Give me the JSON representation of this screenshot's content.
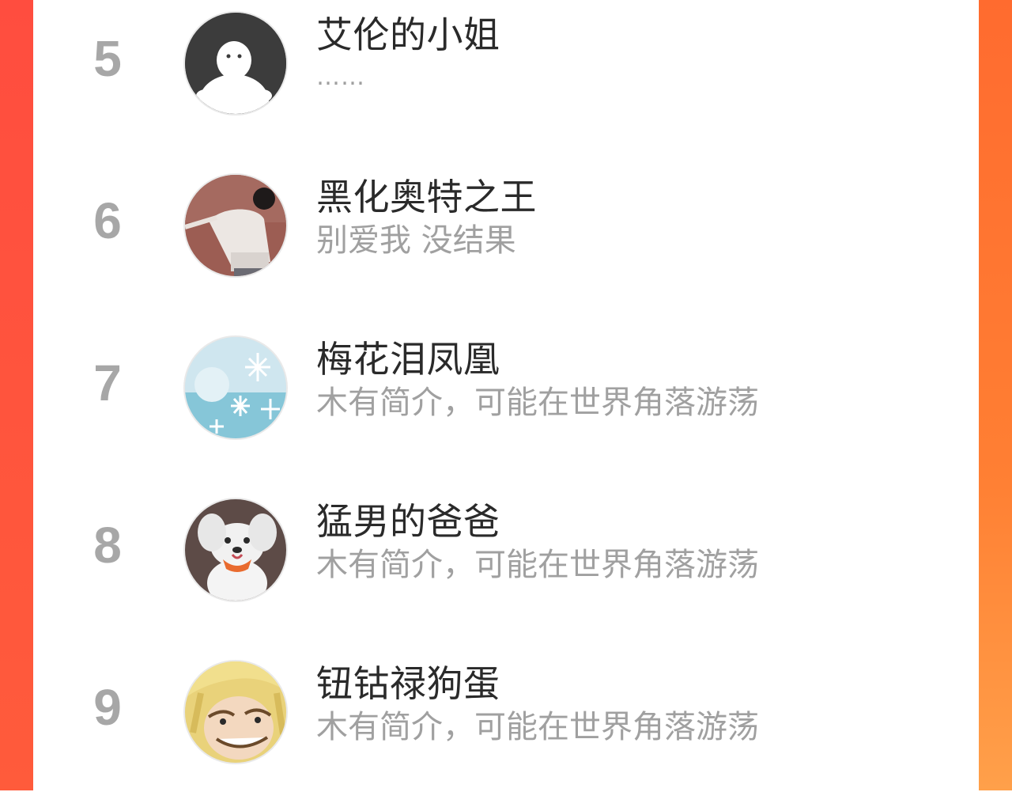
{
  "ranking_list": {
    "items": [
      {
        "rank": "5",
        "name": "艾伦的小姐",
        "intro": "……",
        "avatar": "default-user-avatar"
      },
      {
        "rank": "6",
        "name": "黑化奥特之王",
        "intro": "别爱我 没结果",
        "avatar": "photo-avatar-child"
      },
      {
        "rank": "7",
        "name": "梅花泪凤凰",
        "intro": "木有简介，可能在世界角落游荡",
        "avatar": "photo-avatar-snowflake-cake"
      },
      {
        "rank": "8",
        "name": "猛男的爸爸",
        "intro": "木有简介，可能在世界角落游荡",
        "avatar": "photo-avatar-dog"
      },
      {
        "rank": "9",
        "name": "钮钴禄狗蛋",
        "intro": "木有简介，可能在世界角落游荡",
        "avatar": "photo-avatar-anime-face"
      }
    ]
  },
  "colors": {
    "background_gradient_start": "#ff5a3c",
    "background_gradient_end": "#ff8a3a",
    "panel": "#ffffff",
    "rank_text": "#a7a7a7",
    "name_text": "#2a2a2a",
    "intro_text": "#a0a0a0"
  }
}
